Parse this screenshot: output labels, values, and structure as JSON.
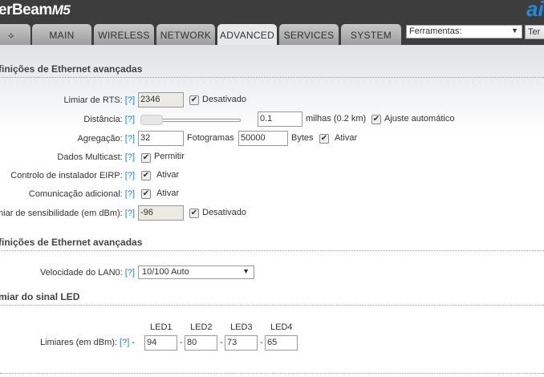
{
  "header": {
    "product": "erBeam",
    "model": "M5",
    "brand": "ai"
  },
  "tabs": [
    {
      "label": "MAIN"
    },
    {
      "label": "WIRELESS"
    },
    {
      "label": "NETWORK"
    },
    {
      "label": "ADVANCED"
    },
    {
      "label": "SERVICES"
    },
    {
      "label": "SYSTEM"
    }
  ],
  "active_tab": "ADVANCED",
  "tools": {
    "value": "Ferramentas:",
    "button": "Ter"
  },
  "help": "[?]",
  "section1": {
    "title": "finições de Ethernet avançadas",
    "rts": {
      "label": "Limiar de RTS:",
      "value": "2346",
      "check": "Desativado"
    },
    "distance": {
      "label": "Distância:",
      "value": "0.1",
      "unit": "milhas (0.2 km)",
      "check": "Ajuste automático",
      "slider_fraction": 0.0
    },
    "aggregation": {
      "label": "Agregação:",
      "frames": "32",
      "frames_unit": "Fotogramas",
      "bytes": "50000",
      "bytes_unit": "Bytes",
      "check": "Ativar"
    },
    "multicast": {
      "label": "Dados Multicast:",
      "check": "Permitir"
    },
    "eirp": {
      "label": "Controlo de instalador EIRP:",
      "check": "Ativar"
    },
    "extra": {
      "label": "Comunicação adicional:",
      "check": "Ativar"
    },
    "sensitivity": {
      "label": "miar de sensibilidade (em dBm):",
      "value": "-96",
      "check": "Desativado"
    }
  },
  "section2": {
    "title": "finições de Ethernet avançadas",
    "lan": {
      "label": "Velocidade do LAN0:",
      "value": "10/100 Auto"
    }
  },
  "section3": {
    "title": "miar do sinal LED",
    "label": "Limiares (em dBm):",
    "leds": [
      {
        "name": "LED1",
        "value": "94"
      },
      {
        "name": "LED2",
        "value": "80"
      },
      {
        "name": "LED3",
        "value": "73"
      },
      {
        "name": "LED4",
        "value": "65"
      }
    ],
    "dash": "-"
  },
  "check_mark": "✔"
}
